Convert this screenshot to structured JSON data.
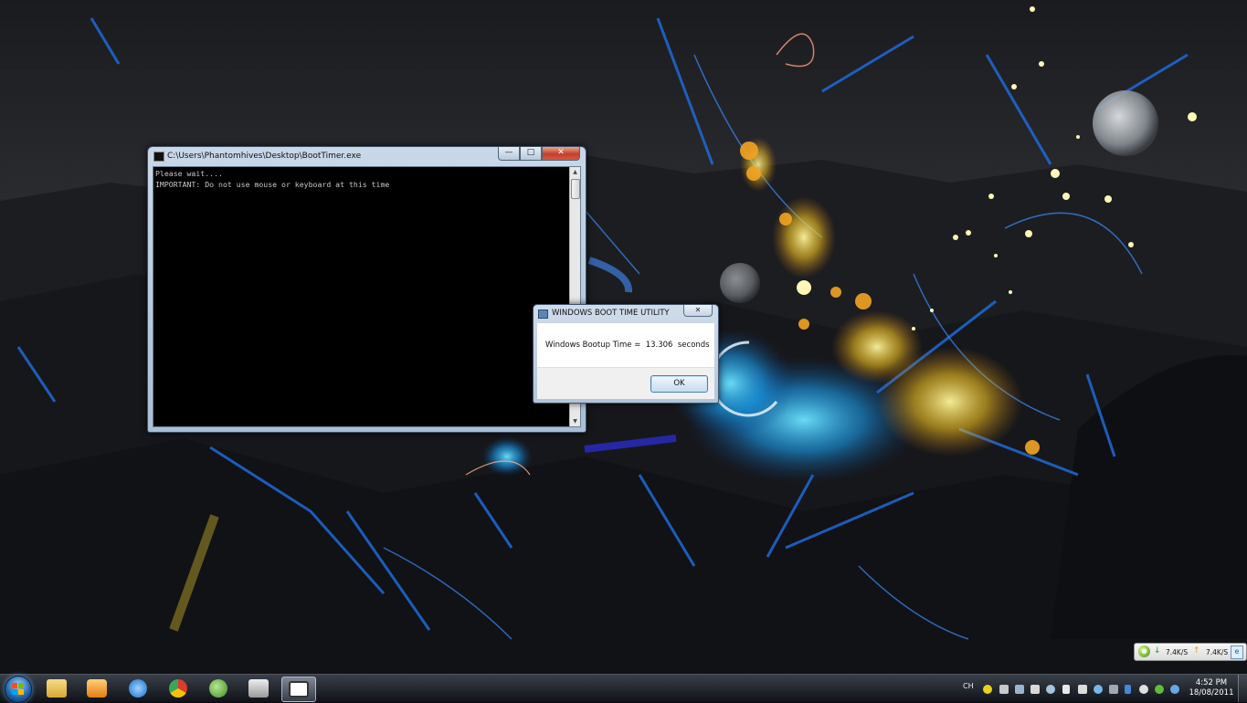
{
  "console": {
    "title": "C:\\Users\\Phantomhives\\Desktop\\BootTimer.exe",
    "line1": "Please wait....",
    "line2": "IMPORTANT: Do not use mouse or keyboard at this time",
    "minimize_label": "—",
    "maximize_label": "□",
    "close_label": "✕"
  },
  "dialog": {
    "title": "WINDOWS BOOT TIME UTILITY",
    "message": "Windows Bootup Time =  13.306  seconds",
    "ok_label": "OK",
    "close_label": "✕"
  },
  "netmeter": {
    "down_arrow": "↓",
    "down_value": "7.4K/S",
    "up_arrow": "↑",
    "up_value": "7.4K/S",
    "globe_glyph": "●",
    "ie_glyph": "e"
  },
  "taskbar": {
    "pins": [
      {
        "name": "explorer-icon",
        "color": "#e8c15a"
      },
      {
        "name": "media-player-icon",
        "color": "#f29a1f"
      },
      {
        "name": "internet-explorer-icon",
        "color": "#2f8ee0"
      },
      {
        "name": "chrome-icon",
        "color": "#dd3b2e"
      },
      {
        "name": "messenger-icon",
        "color": "#5fae3c"
      },
      {
        "name": "app-99-icon",
        "color": "#cfcfcf"
      },
      {
        "name": "console-task-icon",
        "color": "#ffffff"
      }
    ],
    "language": "CH",
    "time": "4:52 PM",
    "date": "18/08/2011"
  },
  "colors": {
    "console_bg": "#000000",
    "console_text": "#c8c8c8",
    "close_red": "#c3402a",
    "accent_blue": "#1e5ea8"
  }
}
